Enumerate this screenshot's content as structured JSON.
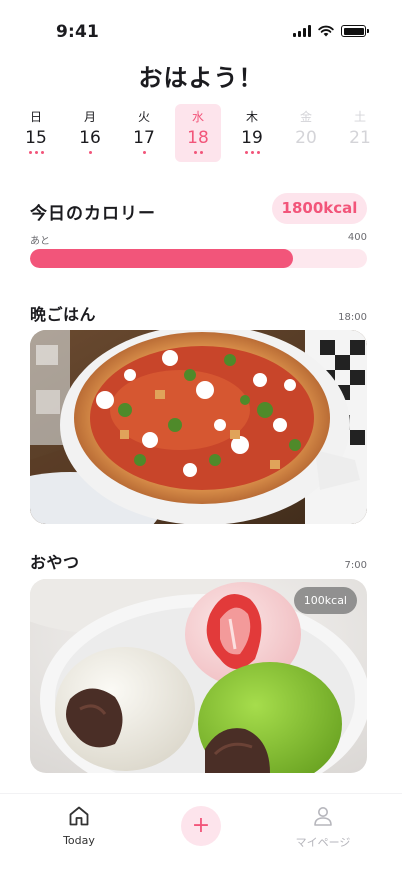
{
  "status_bar": {
    "time": "9:41"
  },
  "greeting": "おはよう！",
  "week": [
    {
      "dow": "日",
      "date": "15",
      "dots": 3,
      "state": "past"
    },
    {
      "dow": "月",
      "date": "16",
      "dots": 1,
      "state": "past"
    },
    {
      "dow": "火",
      "date": "17",
      "dots": 1,
      "state": "past"
    },
    {
      "dow": "水",
      "date": "18",
      "dots": 2,
      "state": "selected"
    },
    {
      "dow": "木",
      "date": "19",
      "dots": 3,
      "state": "past"
    },
    {
      "dow": "金",
      "date": "20",
      "dots": 0,
      "state": "future"
    },
    {
      "dow": "土",
      "date": "21",
      "dots": 0,
      "state": "future"
    }
  ],
  "calories": {
    "title": "今日のカロリー",
    "goal": "1800kcal",
    "remaining_label": "あと",
    "remaining_value": "400",
    "progress_fraction": 0.78
  },
  "meals": [
    {
      "title": "晩ごはん",
      "time": "18:00",
      "image": "pizza-photo"
    },
    {
      "title": "おやつ",
      "time": "7:00",
      "image": "mochi-photo",
      "kcal": "100kcal"
    }
  ],
  "tabbar": {
    "today_label": "Today",
    "add_symbol": "+",
    "mypage_label": "マイページ"
  },
  "colors": {
    "accent": "#f2557a",
    "accent_light": "#fde4ec",
    "text": "#1b1b1f",
    "muted": "#6b6b70"
  }
}
